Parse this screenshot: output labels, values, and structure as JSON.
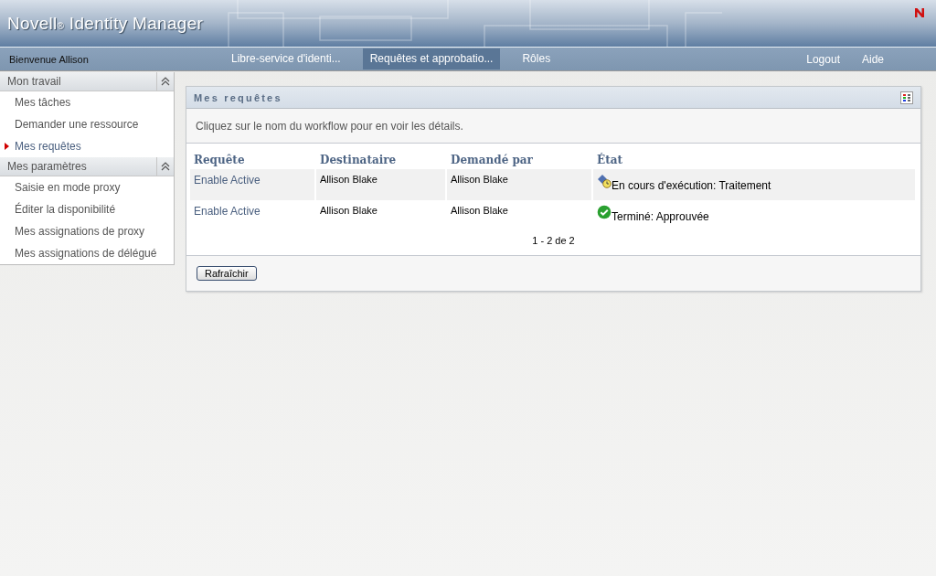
{
  "header": {
    "title": "Novell$_{®}$ Identity Manager"
  },
  "nav": {
    "welcome": "Bienvenue Allison",
    "tabs": [
      {
        "label": "Libre-service d'identi...",
        "selected": false
      },
      {
        "label": "Requêtes et approbatio...",
        "selected": true
      },
      {
        "label": "Rôles",
        "selected": false
      }
    ],
    "links": [
      "Logout",
      "Aide"
    ]
  },
  "sidebar": {
    "sections": [
      {
        "title": "Mon travail",
        "expanded": true,
        "items": [
          {
            "label": "Mes tâches",
            "selected": false
          },
          {
            "label": "Demander une ressource",
            "selected": false
          },
          {
            "label": "Mes requêtes",
            "selected": true
          }
        ]
      },
      {
        "title": "Mes paramètres",
        "expanded": true,
        "items": [
          {
            "label": "Saisie en mode proxy",
            "selected": false
          },
          {
            "label": "Éditer la disponibilité",
            "selected": false
          },
          {
            "label": "Mes assignations de proxy",
            "selected": false
          },
          {
            "label": "Mes assignations de délégué",
            "selected": false
          }
        ]
      }
    ]
  },
  "panel": {
    "title": "Mes requêtes",
    "instructions": "Cliquez sur le nom du workflow pour en voir les détails.",
    "table": {
      "columns": [
        "Requête",
        "Destinataire",
        "Demandé par",
        "État"
      ],
      "rows": [
        {
          "request": "Enable Active",
          "recipient": "Allison Blake",
          "requested_by": "Allison Blake",
          "status": "En cours d'exécution: Traitement",
          "kind": "running"
        },
        {
          "request": "Enable Active",
          "recipient": "Allison Blake",
          "requested_by": "Allison Blake",
          "status": "Terminé: Approuvée",
          "kind": "done"
        }
      ]
    },
    "pagination": "1 - 2 de 2",
    "buttons": [
      "Rafraîchir"
    ]
  }
}
